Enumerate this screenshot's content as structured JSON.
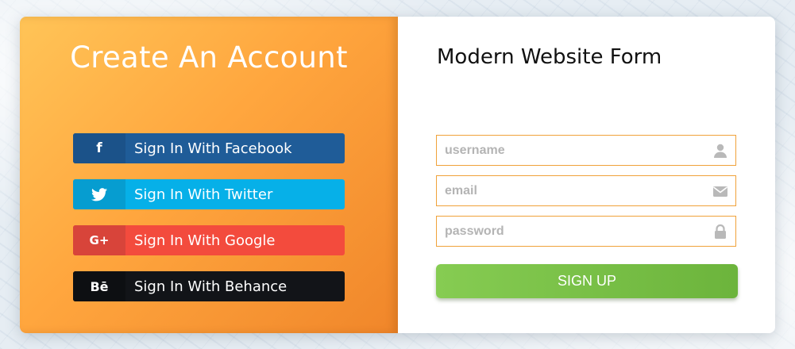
{
  "left_panel": {
    "title": "Create An Account",
    "social_buttons": [
      {
        "icon": "facebook-icon",
        "glyph": "f",
        "label": "Sign In With Facebook",
        "color": "#1f5c98"
      },
      {
        "icon": "twitter-icon",
        "glyph": "",
        "label": "Sign In With Twitter",
        "color": "#06b0e8"
      },
      {
        "icon": "google-plus-icon",
        "glyph": "G+",
        "label": "Sign In With Google",
        "color": "#f34b3d"
      },
      {
        "icon": "behance-icon",
        "glyph": "Bē",
        "label": "Sign In With Behance",
        "color": "#121418"
      }
    ]
  },
  "right_panel": {
    "title": "Modern Website Form",
    "fields": [
      {
        "placeholder": "username",
        "value": "",
        "icon": "user-icon"
      },
      {
        "placeholder": "email",
        "value": "",
        "icon": "envelope-icon"
      },
      {
        "placeholder": "password",
        "value": "",
        "icon": "lock-icon"
      }
    ],
    "submit_label": "SIGN UP"
  },
  "colors": {
    "accent_orange": "#ffa63e",
    "field_border": "#f0a23a",
    "submit_green": "#7cc24a"
  }
}
